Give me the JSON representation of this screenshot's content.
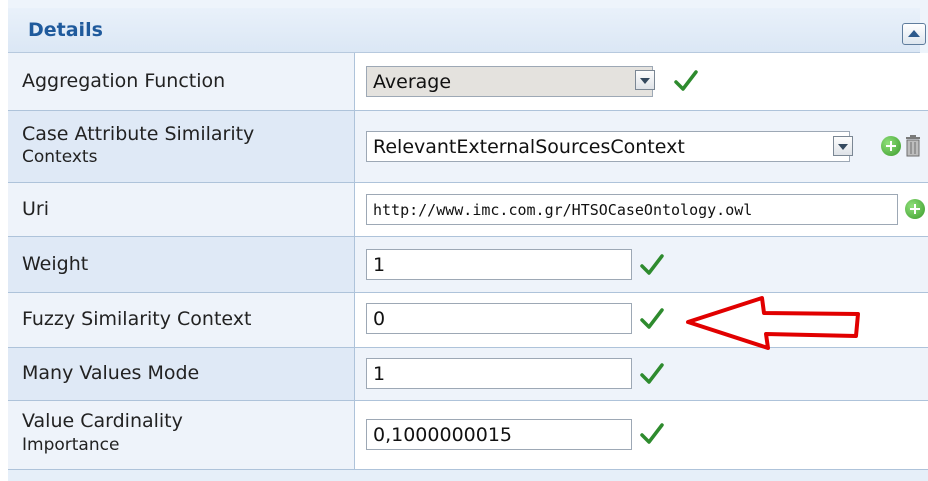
{
  "panel": {
    "title": "Details"
  },
  "rows": [
    {
      "label": "Aggregation Function",
      "value": "Average"
    },
    {
      "label_line1": "Case Attribute Similarity",
      "label_line2": "Contexts",
      "value": "RelevantExternalSourcesContext"
    },
    {
      "label": "Uri",
      "value": "http://www.imc.com.gr/HTSOCaseOntology.owl"
    },
    {
      "label": "Weight",
      "value": "1"
    },
    {
      "label": "Fuzzy Similarity Context",
      "value": "0"
    },
    {
      "label": "Many Values Mode",
      "value": "1"
    },
    {
      "label_line1": "Value Cardinality",
      "label_line2": "Importance",
      "value": "0,1000000015"
    }
  ],
  "icons": {
    "collapse": "collapse-up-icon",
    "check": "green-checkmark-icon",
    "add": "add-plus-icon",
    "delete": "trash-icon",
    "annotation": "red-arrow-icon"
  },
  "colors": {
    "title": "#1f5a9c",
    "check": "#2e8b2e",
    "arrow": "#e10000",
    "border": "#aec3da"
  }
}
